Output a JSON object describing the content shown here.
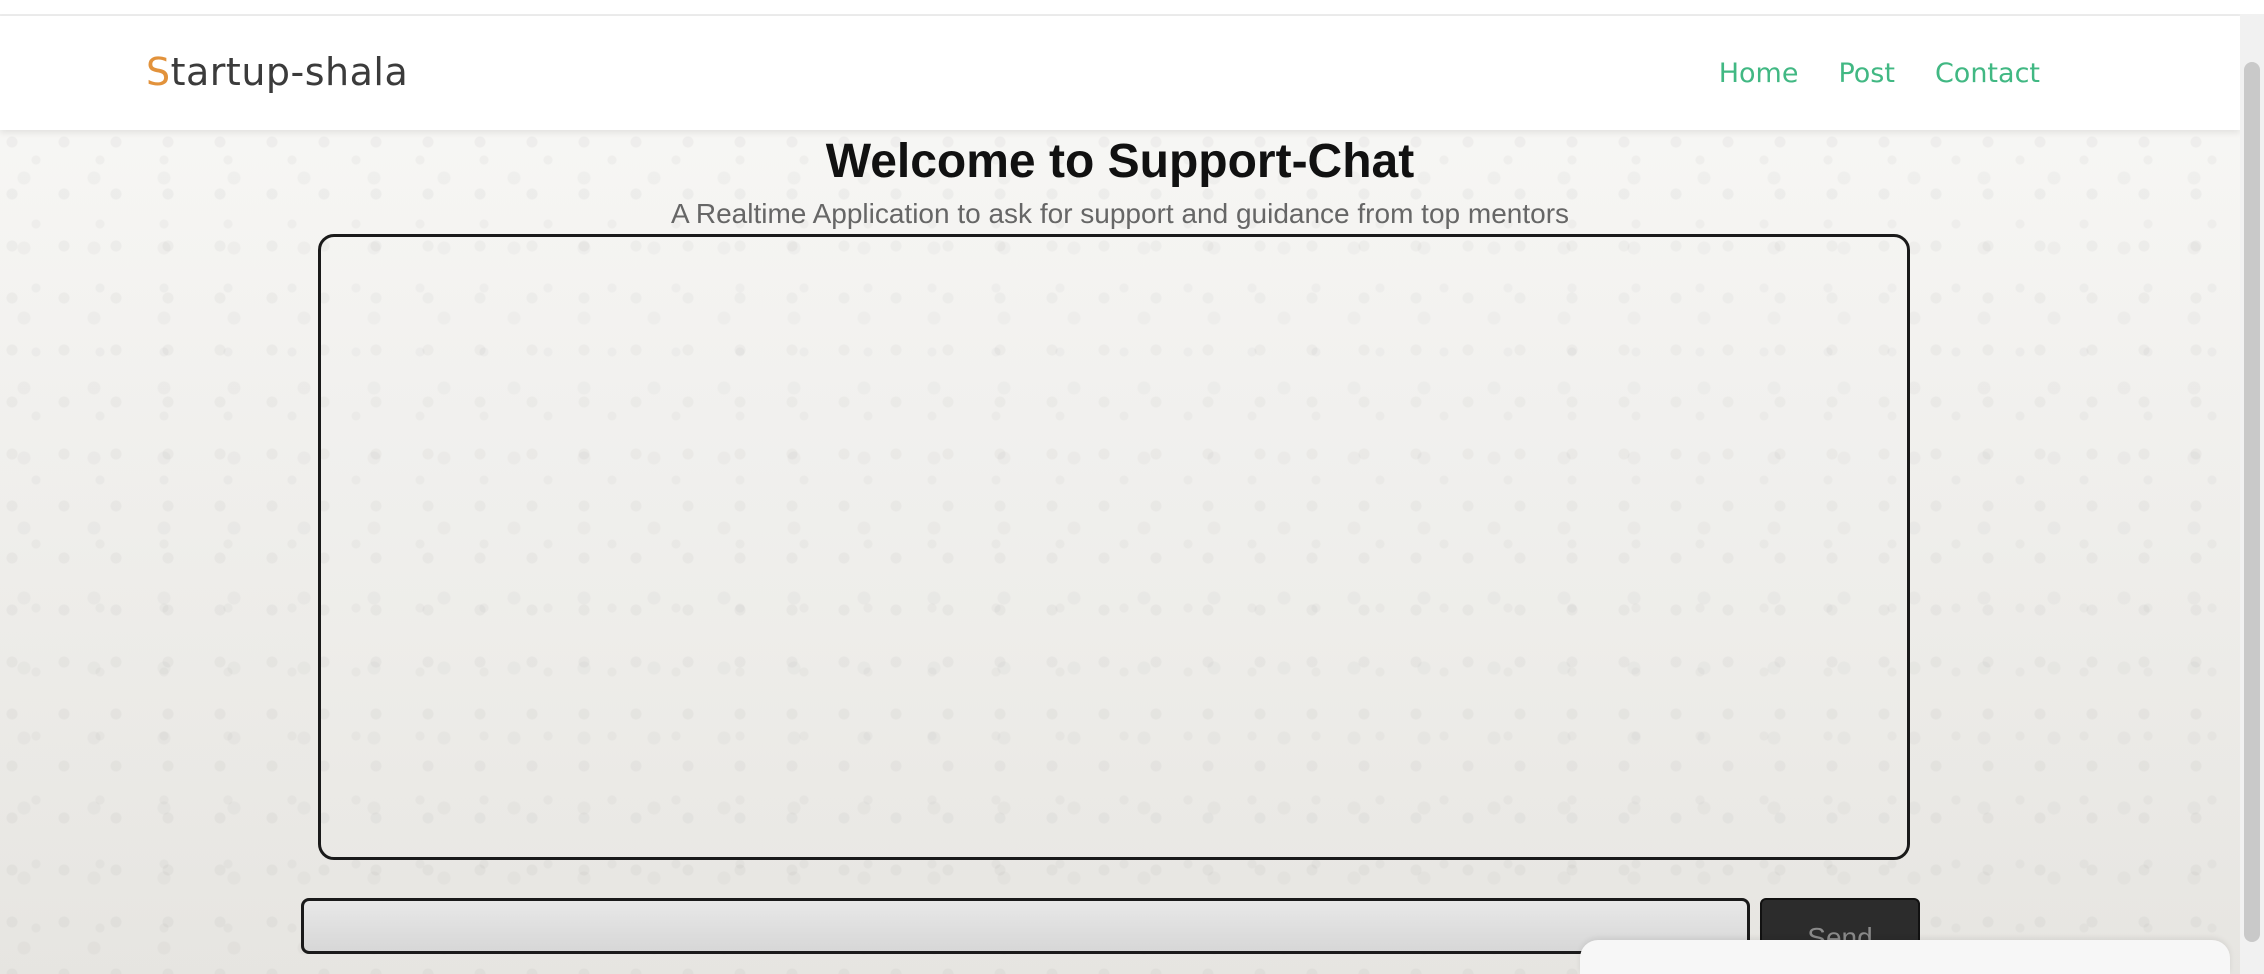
{
  "navbar": {
    "brand_first_letter": "S",
    "brand_rest": "tartup-shala",
    "links": [
      "Home",
      "Post",
      "Contact"
    ]
  },
  "main": {
    "title": "Welcome to Support-Chat",
    "subtitle": "A Realtime Application to ask for support and guidance from top mentors"
  },
  "composer": {
    "input_value": "",
    "send_label": "Send"
  },
  "colors": {
    "brand_accent": "#e2923b",
    "nav_link": "#41b883",
    "send_button_bg": "#2c2c2c"
  }
}
